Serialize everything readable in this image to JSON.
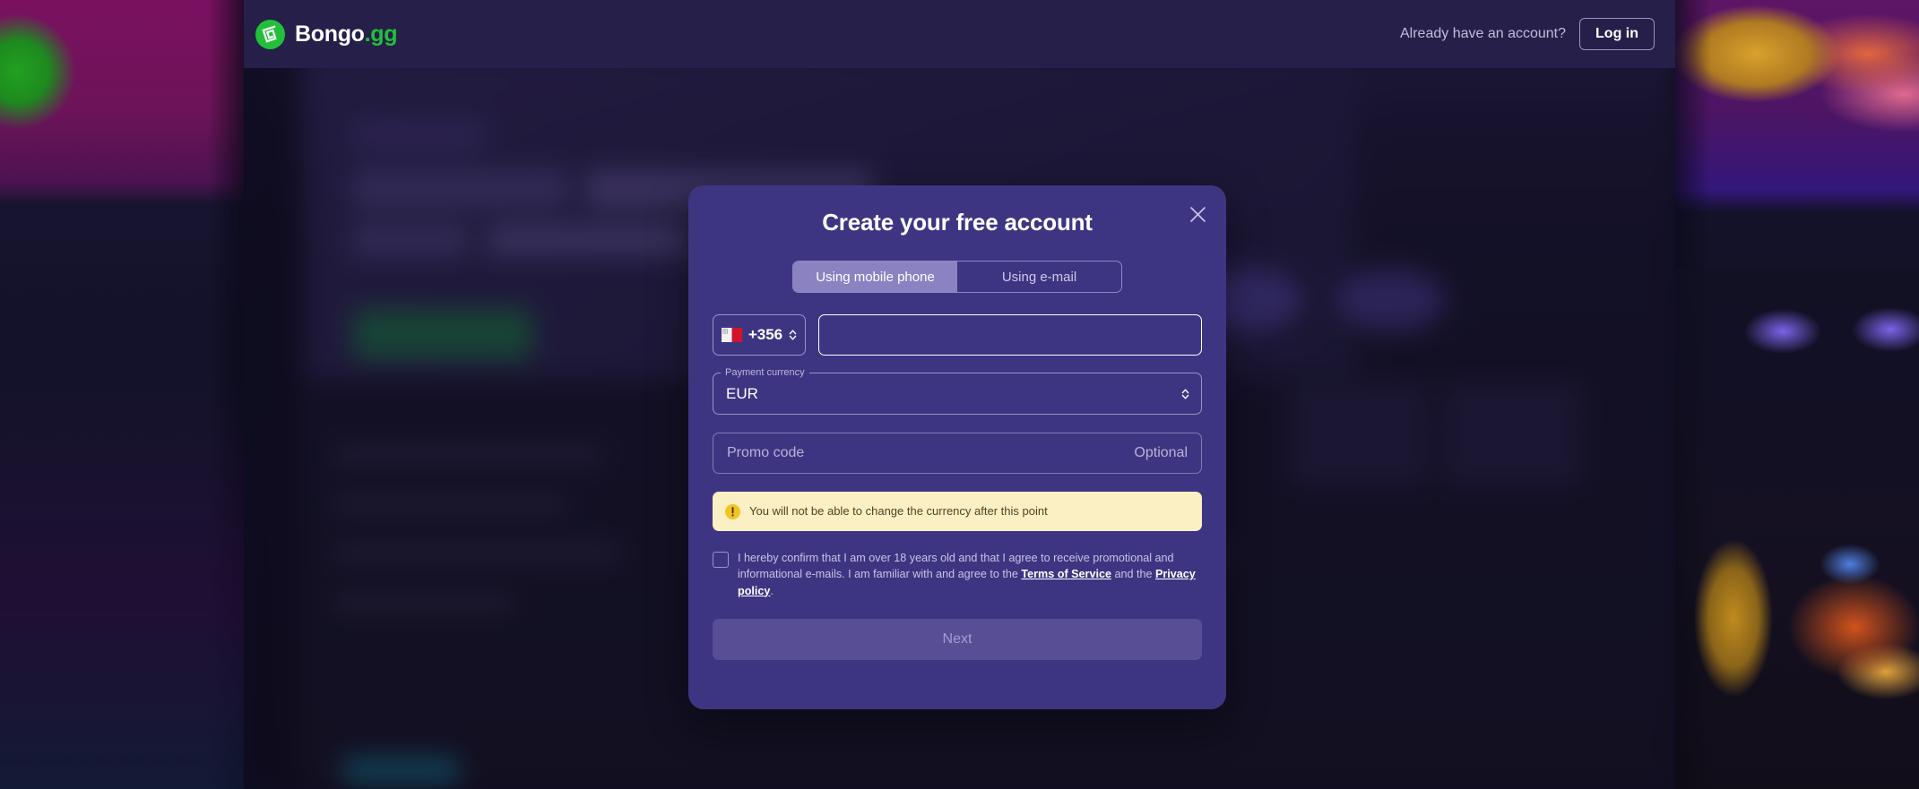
{
  "header": {
    "brand_name": "Bongo",
    "brand_suffix": ".gg",
    "brand_icon": "bongo-spiral-logo-icon",
    "account_prompt": "Already have an account?",
    "login_label": "Log in"
  },
  "modal": {
    "title": "Create your free account",
    "close_icon": "close-icon",
    "tabs": [
      {
        "label": "Using mobile phone",
        "active": true
      },
      {
        "label": "Using e-mail",
        "active": false
      }
    ],
    "phone": {
      "country_flag": "malta-flag-icon",
      "country_code": "+356",
      "selector_icon": "chevron-up-down-icon",
      "number_value": "",
      "number_placeholder": ""
    },
    "currency": {
      "label": "Payment currency",
      "value": "EUR",
      "selector_icon": "chevron-up-down-icon"
    },
    "promo": {
      "placeholder": "Promo code",
      "hint": "Optional",
      "value": ""
    },
    "alert": {
      "icon": "warning-exclamation-icon",
      "text": "You will not be able to change the currency after this point",
      "background_color": "#fbefc4",
      "icon_color": "#f2c521"
    },
    "consent": {
      "checked": false,
      "text_before": "I hereby confirm that I am over 18 years old and that I agree to receive promotional and informational e-mails. I am familiar with and agree to the ",
      "link_terms": "Terms of Service",
      "text_middle": " and the ",
      "link_privacy": "Privacy policy",
      "text_after": "."
    },
    "submit_label": "Next"
  },
  "colors": {
    "modal_background": "#3e3582",
    "header_background": "#251f4a",
    "brand_green": "#22c03a",
    "submit_disabled_bg": "#584e96",
    "tab_active_bg": "#8b82c2"
  }
}
